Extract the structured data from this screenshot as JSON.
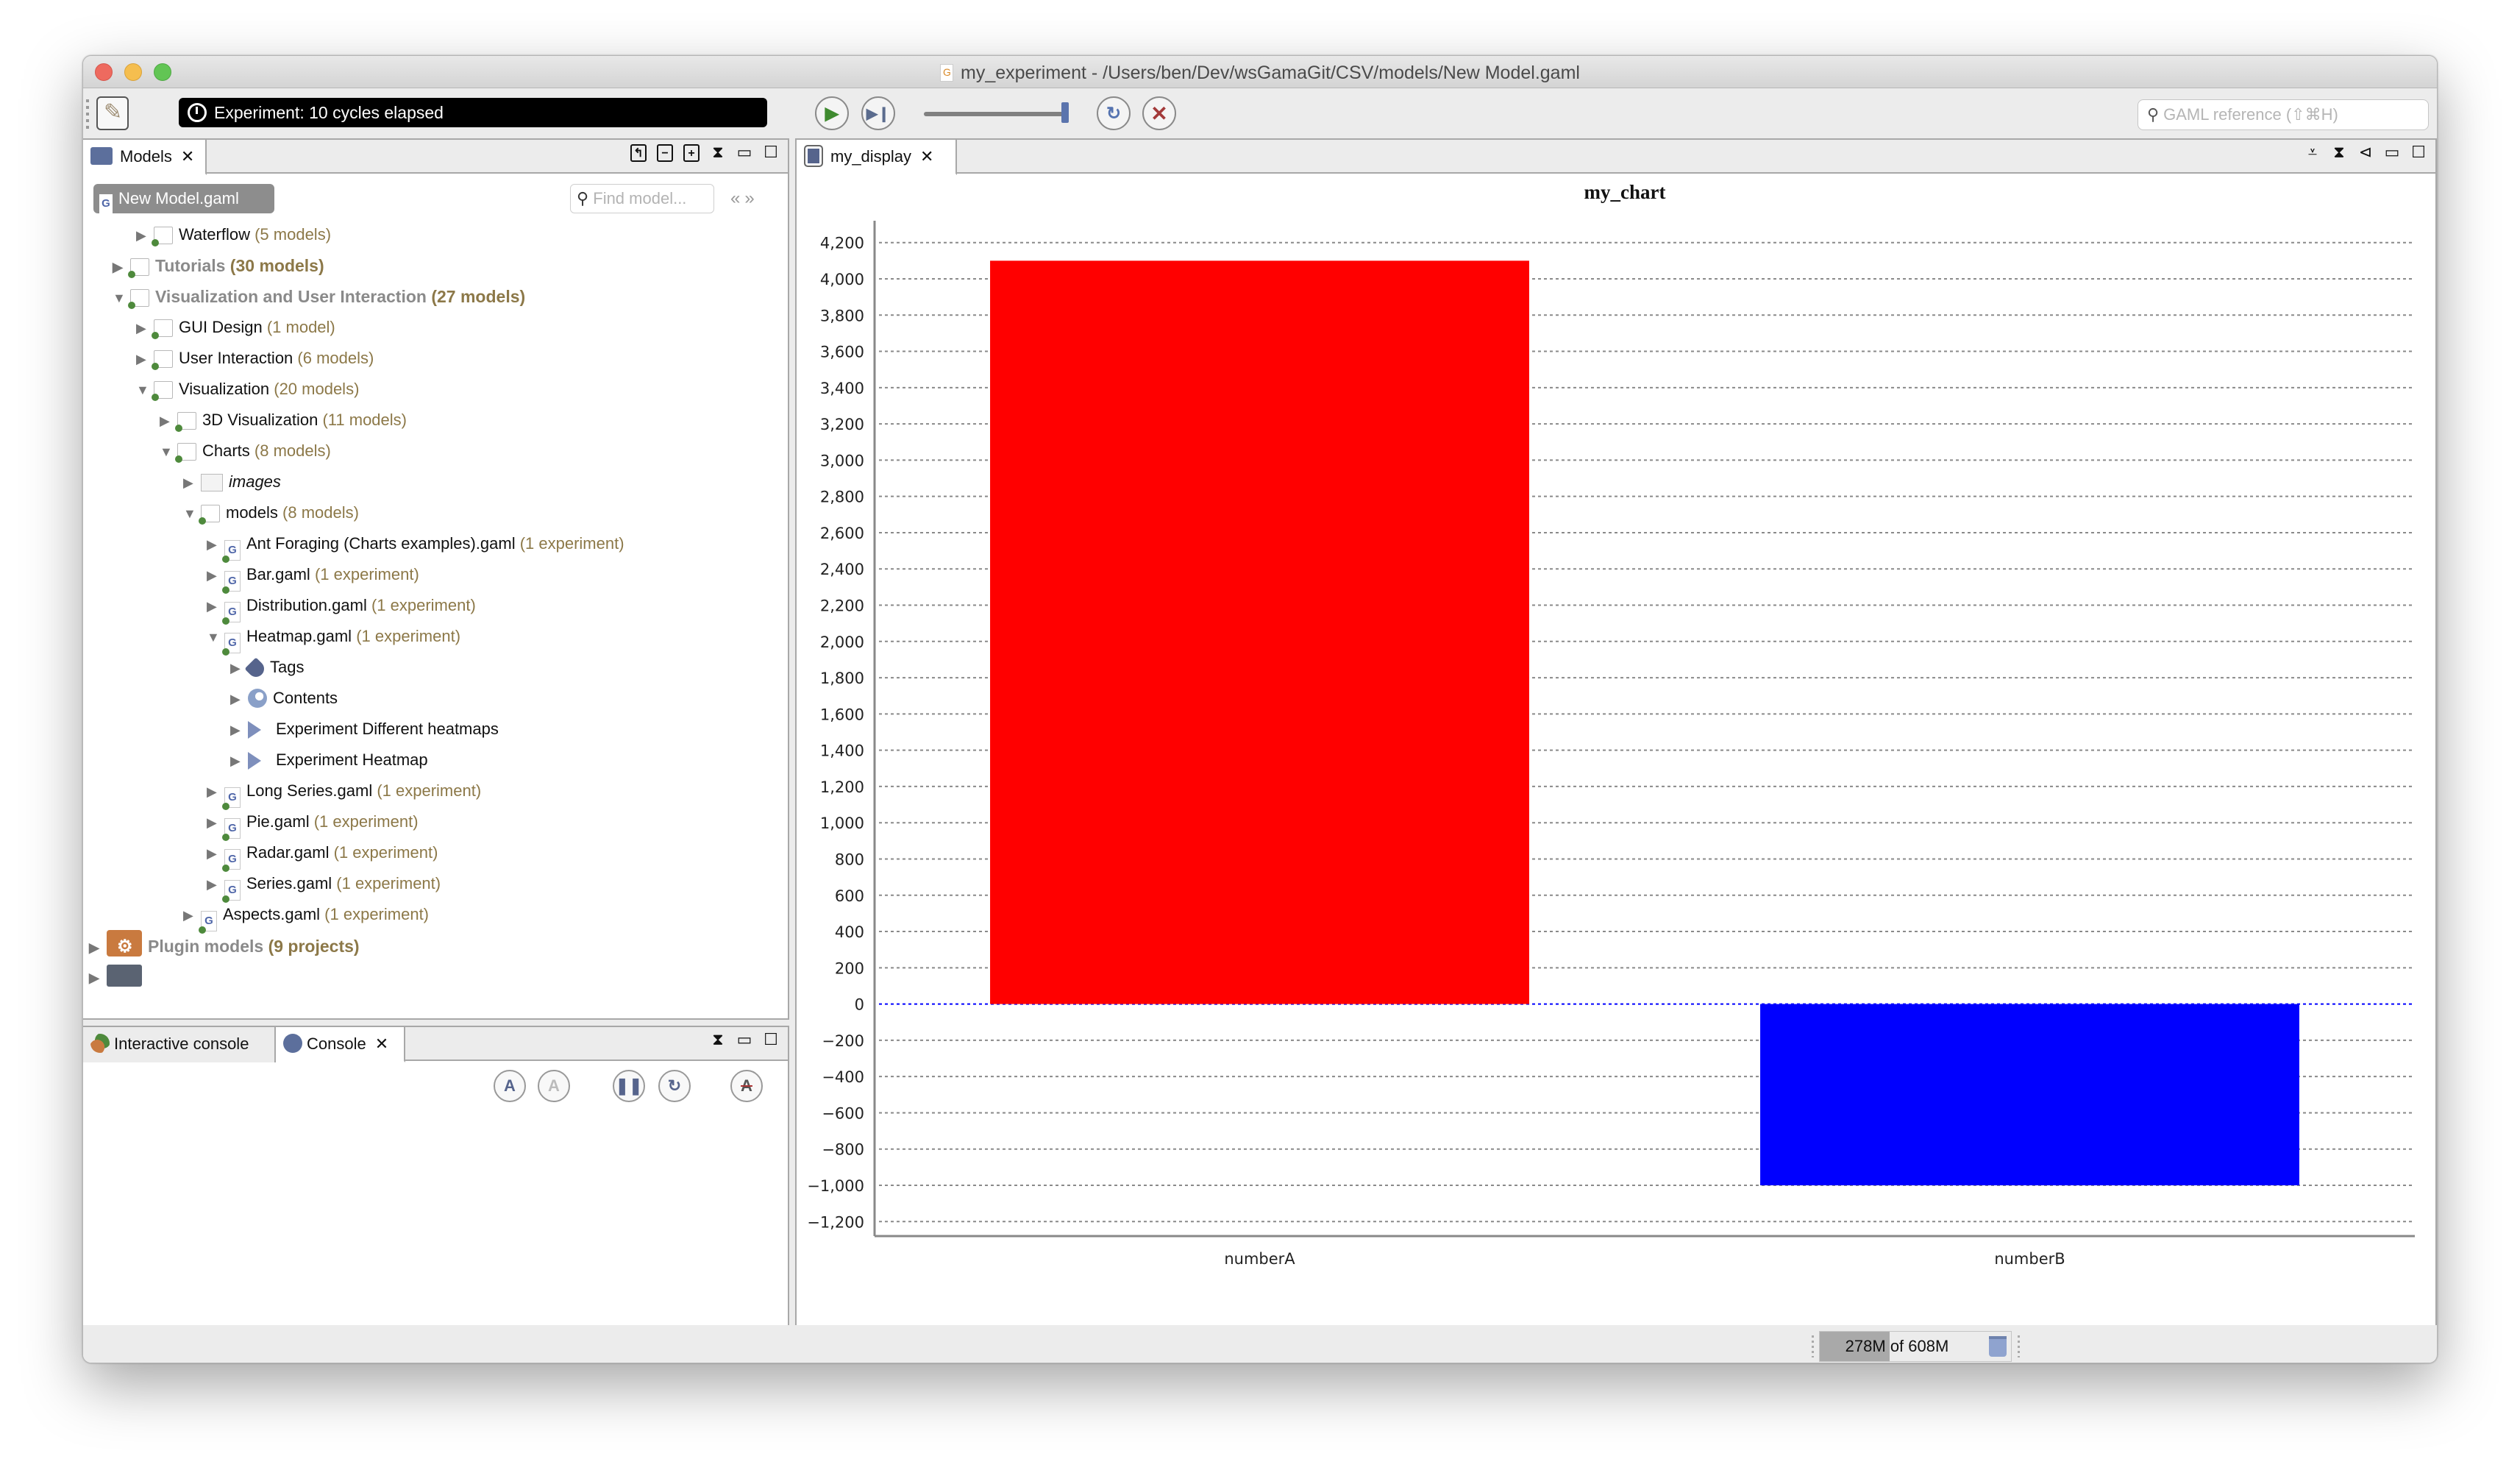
{
  "window": {
    "title": "my_experiment - /Users/ben/Dev/wsGamaGit/CSV/models/New Model.gaml"
  },
  "toolbar": {
    "experiment_status": "Experiment: 10 cycles elapsed",
    "speed_slider_value": 1.0,
    "search_placeholder": "GAML reference (⇧⌘H)"
  },
  "models_view": {
    "tab_label": "Models",
    "current_model_badge": "New Model.gaml",
    "find_placeholder": "Find model...",
    "tree": [
      {
        "label": "Waterflow",
        "count": "(5 models)",
        "depth": 2,
        "type": "folder",
        "expanded": false
      },
      {
        "label": "Tutorials",
        "count": "(30 models)",
        "depth": 1,
        "type": "folder",
        "expanded": false,
        "top_level": true
      },
      {
        "label": "Visualization and User Interaction",
        "count": "(27 models)",
        "depth": 1,
        "type": "folder",
        "expanded": true,
        "top_level": true
      },
      {
        "label": "GUI Design",
        "count": "(1 model)",
        "depth": 2,
        "type": "folder",
        "expanded": false
      },
      {
        "label": "User Interaction",
        "count": "(6 models)",
        "depth": 2,
        "type": "folder",
        "expanded": false
      },
      {
        "label": "Visualization",
        "count": "(20 models)",
        "depth": 2,
        "type": "folder",
        "expanded": true
      },
      {
        "label": "3D Visualization",
        "count": "(11 models)",
        "depth": 3,
        "type": "folder",
        "expanded": false
      },
      {
        "label": "Charts",
        "count": "(8 models)",
        "depth": 3,
        "type": "folder",
        "expanded": true
      },
      {
        "label": "images",
        "count": "",
        "depth": 4,
        "type": "images",
        "expanded": false,
        "italic": true
      },
      {
        "label": "models",
        "count": "(8 models)",
        "depth": 4,
        "type": "folder",
        "expanded": true
      },
      {
        "label": "Ant Foraging (Charts examples).gaml",
        "count": "(1 experiment)",
        "depth": 5,
        "type": "gfile",
        "expanded": false
      },
      {
        "label": "Bar.gaml",
        "count": "(1 experiment)",
        "depth": 5,
        "type": "gfile",
        "expanded": false
      },
      {
        "label": "Distribution.gaml",
        "count": "(1 experiment)",
        "depth": 5,
        "type": "gfile",
        "expanded": false
      },
      {
        "label": "Heatmap.gaml",
        "count": "(1 experiment)",
        "depth": 5,
        "type": "gfile",
        "expanded": true
      },
      {
        "label": "Tags",
        "count": "",
        "depth": 6,
        "type": "tag",
        "expanded": false
      },
      {
        "label": "Contents",
        "count": "",
        "depth": 6,
        "type": "globe",
        "expanded": false
      },
      {
        "label": "Experiment Different heatmaps",
        "count": "",
        "depth": 6,
        "type": "exp",
        "expanded": false
      },
      {
        "label": "Experiment Heatmap",
        "count": "",
        "depth": 6,
        "type": "exp",
        "expanded": false
      },
      {
        "label": "Long Series.gaml",
        "count": "(1 experiment)",
        "depth": 5,
        "type": "gfile",
        "expanded": false
      },
      {
        "label": "Pie.gaml",
        "count": "(1 experiment)",
        "depth": 5,
        "type": "gfile",
        "expanded": false
      },
      {
        "label": "Radar.gaml",
        "count": "(1 experiment)",
        "depth": 5,
        "type": "gfile",
        "expanded": false
      },
      {
        "label": "Series.gaml",
        "count": "(1 experiment)",
        "depth": 5,
        "type": "gfile",
        "expanded": false
      },
      {
        "label": "Aspects.gaml",
        "count": "(1 experiment)",
        "depth": 4,
        "type": "gfile",
        "expanded": false
      },
      {
        "label": "Plugin models",
        "count": "(9 projects)",
        "depth": 0,
        "type": "plugin",
        "expanded": false,
        "top_level": true
      },
      {
        "label": "",
        "count": "",
        "depth": 0,
        "type": "testproj",
        "expanded": false,
        "top_level": true,
        "clipped": true
      }
    ]
  },
  "console_view": {
    "tabs": [
      {
        "label": "Interactive console",
        "active": false
      },
      {
        "label": "Console",
        "active": true
      }
    ],
    "buttons": [
      "increase-font",
      "decrease-font",
      "pause",
      "refresh",
      "no-wrap"
    ]
  },
  "display_view": {
    "tab_label": "my_display"
  },
  "status_bar": {
    "memory_used": "278M",
    "memory_total": "608M",
    "memory_text_of": "of",
    "memory_fraction": 0.457
  },
  "chart_data": {
    "type": "bar",
    "title": "my_chart",
    "categories": [
      "numberA",
      "numberB"
    ],
    "values": [
      4100,
      -1000
    ],
    "colors": [
      "#ff0000",
      "#0000ff"
    ],
    "xlabel": "",
    "ylabel": "",
    "ylim": [
      -1280,
      4280
    ],
    "yticks": [
      -1200,
      -1000,
      -800,
      -600,
      -400,
      -200,
      0,
      200,
      400,
      600,
      800,
      1000,
      1200,
      1400,
      1600,
      1800,
      2000,
      2200,
      2400,
      2600,
      2800,
      3000,
      3200,
      3400,
      3600,
      3800,
      4000,
      4200
    ],
    "grid": true,
    "zero_line_color": "#0000ff",
    "legend": "none"
  }
}
